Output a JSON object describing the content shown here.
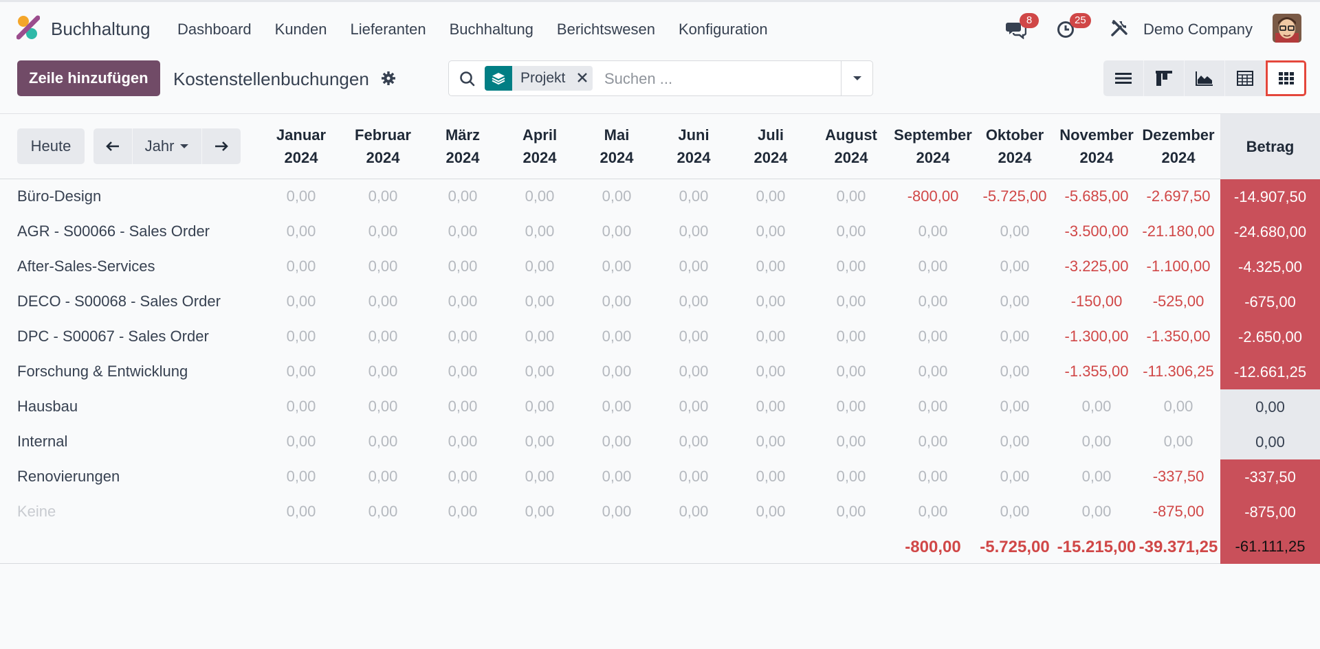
{
  "navbar": {
    "app_name": "Buchhaltung",
    "menu": [
      "Dashboard",
      "Kunden",
      "Lieferanten",
      "Buchhaltung",
      "Berichtswesen",
      "Konfiguration"
    ],
    "messages_count": "8",
    "activities_count": "25",
    "company": "Demo Company",
    "icons": [
      "app-logo",
      "chat-bubbles-icon",
      "clock-icon",
      "tools-icon",
      "user-avatar"
    ]
  },
  "control_panel": {
    "add_line_label": "Zeile hinzufügen",
    "title": "Kostenstellenbuchungen",
    "search": {
      "facet_label": "Projekt",
      "placeholder": "Suchen ..."
    },
    "views": [
      "list-view",
      "kanban-view",
      "graph-view",
      "pivot-view",
      "grid-view"
    ],
    "active_view": "grid-view"
  },
  "grid": {
    "today_label": "Heute",
    "range_label": "Jahr",
    "columns": [
      {
        "month": "Januar",
        "year": "2024"
      },
      {
        "month": "Februar",
        "year": "2024"
      },
      {
        "month": "März",
        "year": "2024"
      },
      {
        "month": "April",
        "year": "2024"
      },
      {
        "month": "Mai",
        "year": "2024"
      },
      {
        "month": "Juni",
        "year": "2024"
      },
      {
        "month": "Juli",
        "year": "2024"
      },
      {
        "month": "August",
        "year": "2024"
      },
      {
        "month": "September",
        "year": "2024"
      },
      {
        "month": "Oktober",
        "year": "2024"
      },
      {
        "month": "November",
        "year": "2024"
      },
      {
        "month": "Dezember",
        "year": "2024"
      }
    ],
    "total_header": "Betrag",
    "rows": [
      {
        "label": "Büro-Design",
        "values": [
          "0,00",
          "0,00",
          "0,00",
          "0,00",
          "0,00",
          "0,00",
          "0,00",
          "0,00",
          "-800,00",
          "-5.725,00",
          "-5.685,00",
          "-2.697,50"
        ],
        "total": "-14.907,50"
      },
      {
        "label": "AGR - S00066 - Sales Order",
        "values": [
          "0,00",
          "0,00",
          "0,00",
          "0,00",
          "0,00",
          "0,00",
          "0,00",
          "0,00",
          "0,00",
          "0,00",
          "-3.500,00",
          "-21.180,00"
        ],
        "total": "-24.680,00"
      },
      {
        "label": "After-Sales-Services",
        "values": [
          "0,00",
          "0,00",
          "0,00",
          "0,00",
          "0,00",
          "0,00",
          "0,00",
          "0,00",
          "0,00",
          "0,00",
          "-3.225,00",
          "-1.100,00"
        ],
        "total": "-4.325,00"
      },
      {
        "label": "DECO - S00068 - Sales Order",
        "values": [
          "0,00",
          "0,00",
          "0,00",
          "0,00",
          "0,00",
          "0,00",
          "0,00",
          "0,00",
          "0,00",
          "0,00",
          "-150,00",
          "-525,00"
        ],
        "total": "-675,00"
      },
      {
        "label": "DPC - S00067 - Sales Order",
        "values": [
          "0,00",
          "0,00",
          "0,00",
          "0,00",
          "0,00",
          "0,00",
          "0,00",
          "0,00",
          "0,00",
          "0,00",
          "-1.300,00",
          "-1.350,00"
        ],
        "total": "-2.650,00"
      },
      {
        "label": "Forschung & Entwicklung",
        "values": [
          "0,00",
          "0,00",
          "0,00",
          "0,00",
          "0,00",
          "0,00",
          "0,00",
          "0,00",
          "0,00",
          "0,00",
          "-1.355,00",
          "-11.306,25"
        ],
        "total": "-12.661,25"
      },
      {
        "label": "Hausbau",
        "values": [
          "0,00",
          "0,00",
          "0,00",
          "0,00",
          "0,00",
          "0,00",
          "0,00",
          "0,00",
          "0,00",
          "0,00",
          "0,00",
          "0,00"
        ],
        "total": "0,00"
      },
      {
        "label": "Internal",
        "values": [
          "0,00",
          "0,00",
          "0,00",
          "0,00",
          "0,00",
          "0,00",
          "0,00",
          "0,00",
          "0,00",
          "0,00",
          "0,00",
          "0,00"
        ],
        "total": "0,00"
      },
      {
        "label": "Renovierungen",
        "values": [
          "0,00",
          "0,00",
          "0,00",
          "0,00",
          "0,00",
          "0,00",
          "0,00",
          "0,00",
          "0,00",
          "0,00",
          "0,00",
          "-337,50"
        ],
        "total": "-337,50"
      },
      {
        "label": "Keine",
        "muted": true,
        "values": [
          "0,00",
          "0,00",
          "0,00",
          "0,00",
          "0,00",
          "0,00",
          "0,00",
          "0,00",
          "0,00",
          "0,00",
          "0,00",
          "-875,00"
        ],
        "total": "-875,00"
      }
    ],
    "column_totals": [
      "",
      "",
      "",
      "",
      "",
      "",
      "",
      "",
      "-800,00",
      "-5.725,00",
      "-15.215,00",
      "-39.371,25"
    ],
    "grand_total": "-61.111,25",
    "colors": {
      "negative": "#d04747",
      "total_negative_bg": "#c9505a",
      "zero_text": "#b5b9bf",
      "primary": "#714b67",
      "facet": "#017e84"
    }
  }
}
